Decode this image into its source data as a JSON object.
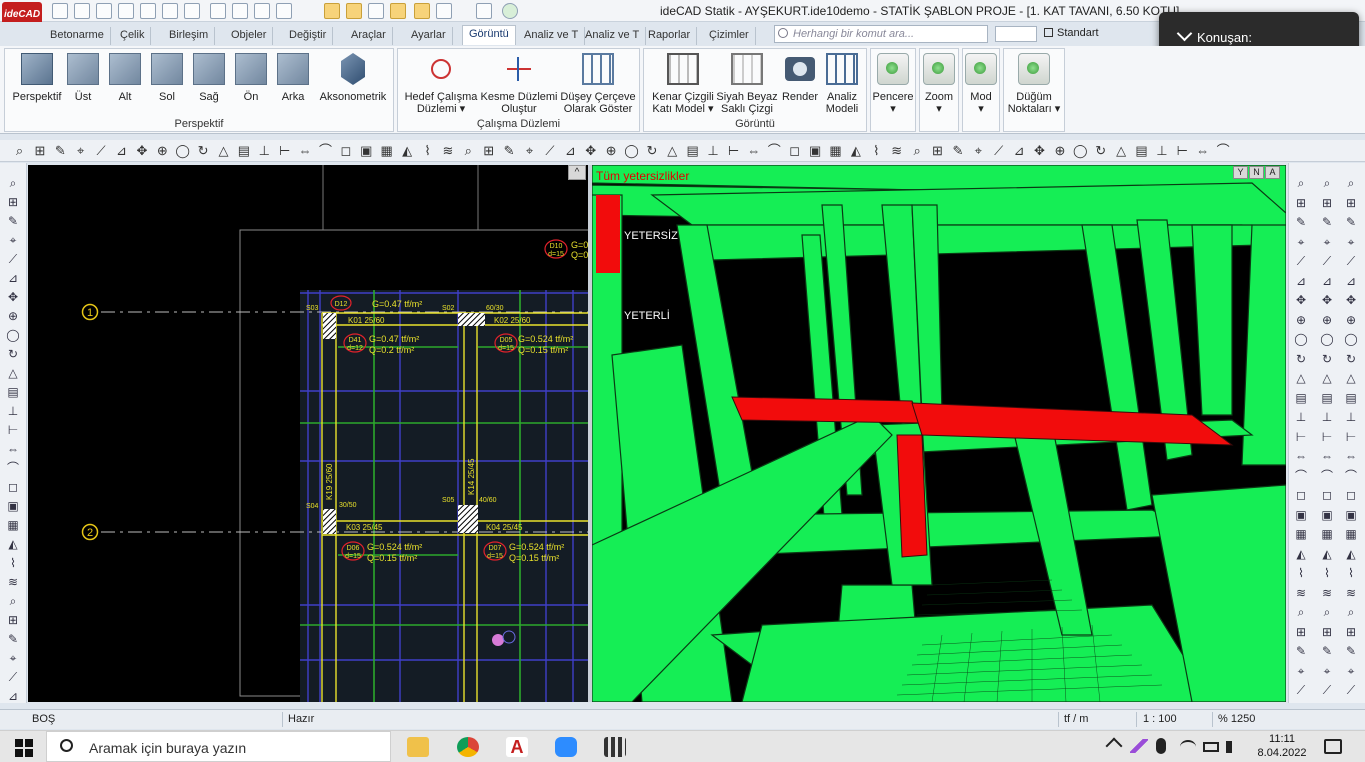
{
  "app": {
    "logo_text": "ideCAD",
    "title": "ideCAD Statik - AYŞEKURT.ide10demo - STATİK ŞABLON PROJE - [1. KAT TAVANI,  6.50 KOTU]"
  },
  "tabs": [
    "Betonarme",
    "Çelik",
    "Birleşim",
    "Objeler",
    "Değiştir",
    "Araçlar",
    "Ayarlar",
    "Görüntü",
    "Analiz ve T",
    "Analiz ve T",
    "Raporlar",
    "Çizimler"
  ],
  "active_tab": "Görüntü",
  "command_search": {
    "placeholder": "Herhangi bir komut ara..."
  },
  "style_select": {
    "value": "Standart"
  },
  "notification": {
    "label": "Konuşan:"
  },
  "ribbon": {
    "perspektif": {
      "label": "Perspektif",
      "buttons": [
        "Perspektif",
        "Üst",
        "Alt",
        "Sol",
        "Sağ",
        "Ön",
        "Arka",
        "Aksonometrik"
      ]
    },
    "calisma": {
      "label": "Çalışma Düzlemi",
      "buttons": [
        {
          "line1": "Hedef Çalışma",
          "line2": "Düzlemi ▾"
        },
        {
          "line1": "Kesme Düzlemi",
          "line2": "Oluştur"
        },
        {
          "line1": "Düşey Çerçeve",
          "line2": "Olarak Göster"
        }
      ]
    },
    "goruntu": {
      "label": "Görüntü",
      "buttons": [
        {
          "line1": "Kenar Çizgili",
          "line2": "Katı Model ▾"
        },
        {
          "line1": "Siyah Beyaz",
          "line2": "Saklı Çizgi"
        },
        {
          "line1": "Render",
          "line2": ""
        },
        {
          "line1": "Analiz",
          "line2": "Modeli"
        }
      ]
    },
    "single": [
      {
        "line1": "Pencere",
        "line2": "▾"
      },
      {
        "line1": "Zoom",
        "line2": "▾"
      },
      {
        "line1": "Mod",
        "line2": "▾"
      },
      {
        "line1": "Düğüm",
        "line2": "Noktaları ▾"
      }
    ]
  },
  "plan_view": {
    "axes": [
      "1",
      "2"
    ],
    "slabs": [
      {
        "id": "D12",
        "g": "G=0.47 tf/m²",
        "q": "Q=0.2 tf/m²",
        "d": "d=12"
      },
      {
        "id": "D41",
        "g": "G=0.47 tf/m²",
        "q": "Q=0.2 tf/m²",
        "d": "d=12"
      },
      {
        "id": "D05",
        "g": "G=0.524 tf/m²",
        "q": "Q=0.15 tf/m²",
        "d": "d=15"
      },
      {
        "id": "D06",
        "g": "G=0.524 tf/m²",
        "q": "Q=0.15 tf/m²",
        "d": "d=15"
      },
      {
        "id": "D07",
        "g": "G=0.524 tf/m²",
        "q": "Q=0.15 tf/m²",
        "d": "d=15"
      },
      {
        "id": "D10",
        "g": "G=0",
        "q": "Q=0",
        "d": "d=15"
      }
    ],
    "beams": [
      "K01 25/60",
      "K02 25/60",
      "K03 25/45",
      "K04 25/45",
      "K19 25/60",
      "K14 25/45"
    ],
    "columns": [
      "S03",
      "S02",
      "S04",
      "S05"
    ],
    "column_dims": [
      "60/30",
      "30/50",
      "40/60"
    ]
  },
  "view3d": {
    "title": "Tüm yetersizlikler",
    "legend": {
      "bad": "YETERSİZ",
      "good": "YETERLİ"
    },
    "controls": [
      "Y",
      "N",
      "A"
    ],
    "colors": {
      "good": "#15ee55",
      "bad": "#f20c0c"
    }
  },
  "status": {
    "left": "BOŞ",
    "state": "Hazır",
    "unit": "tf / m",
    "scale": "1 : 100",
    "zoom": "% 1250"
  },
  "taskbar": {
    "search_placeholder": "Aramak için buraya yazın",
    "time": "11:11",
    "date": "8.04.2022"
  }
}
